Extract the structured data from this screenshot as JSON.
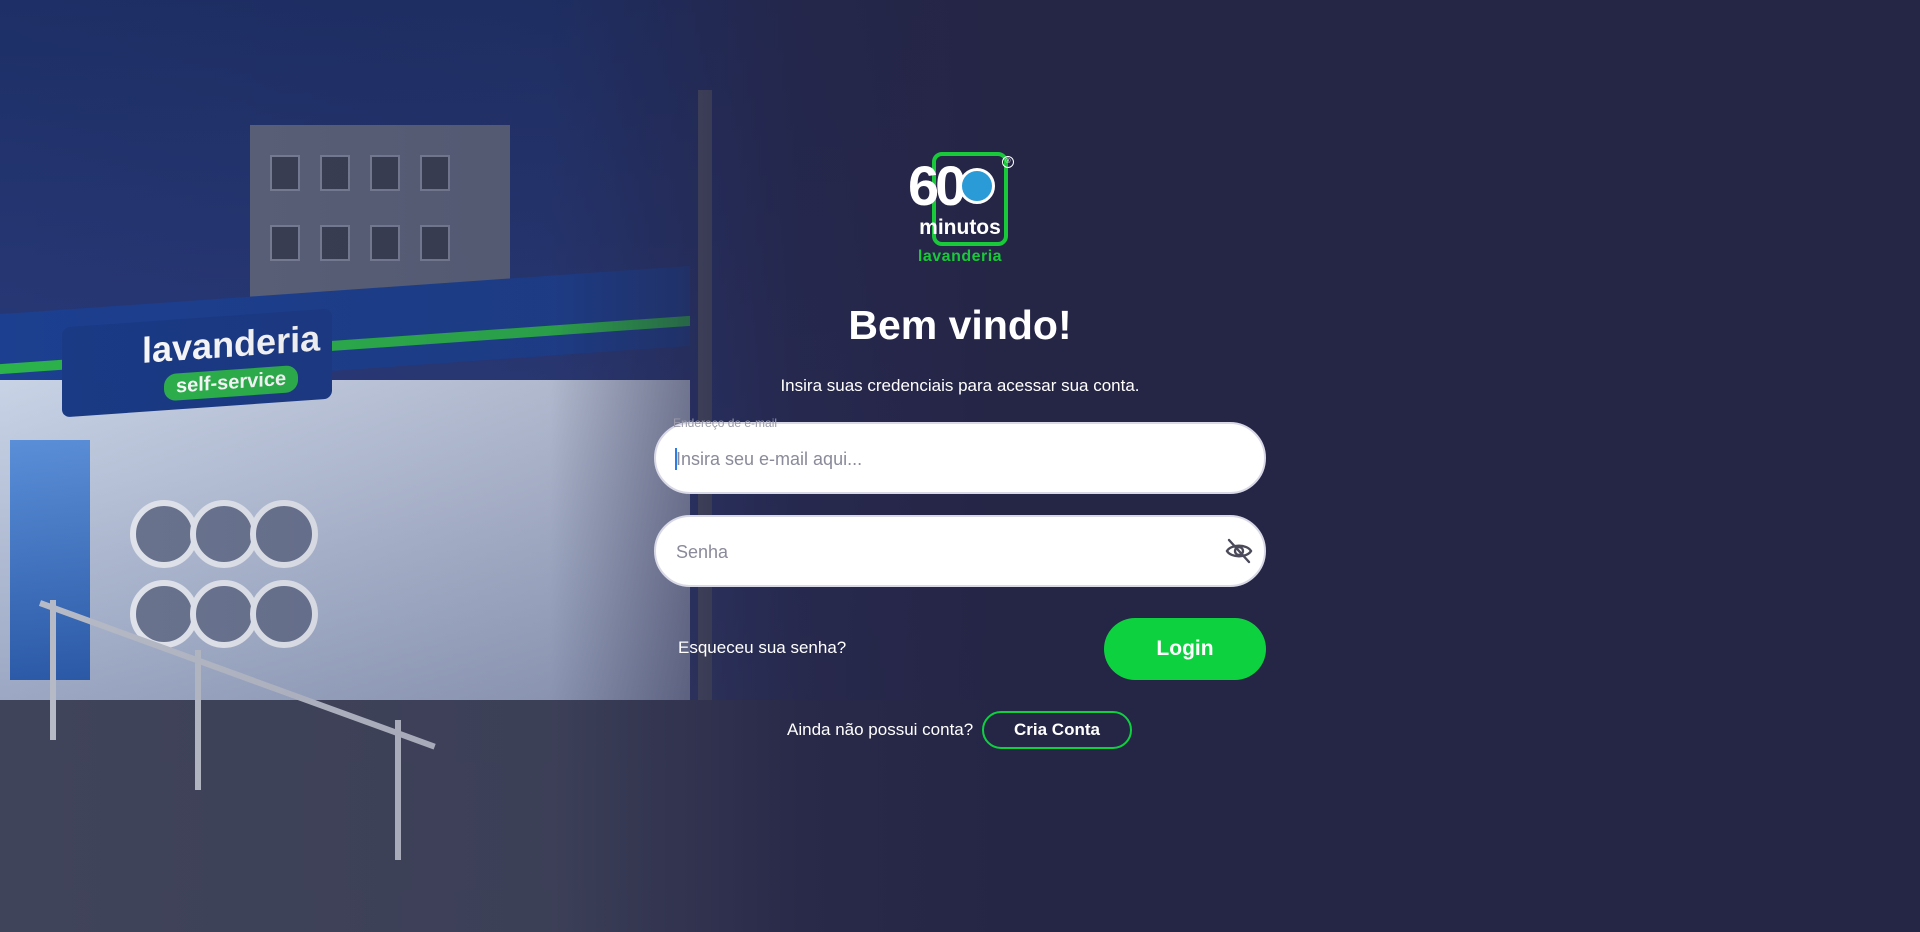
{
  "background": {
    "store_sign_text": "lavanderia",
    "store_sign_pill": "self-service"
  },
  "logo": {
    "number": "60",
    "word": "minutos",
    "subword": "lavanderia",
    "registered_mark": "®",
    "accent_color": "#19c93a"
  },
  "login": {
    "title": "Bem vindo!",
    "subtitle": "Insira suas credenciais para acessar sua conta.",
    "email": {
      "label": "Endereço de e-mail",
      "placeholder": "Insira seu e-mail aqui...",
      "value": ""
    },
    "password": {
      "placeholder": "Senha",
      "value": "",
      "toggle_icon": "eye-off-icon"
    },
    "forgot_password": "Esqueceu sua senha?",
    "login_button": "Login",
    "no_account_text": "Ainda não possui conta?",
    "create_account_button": "Cria Conta"
  },
  "colors": {
    "background": "#252546",
    "primary_green": "#0ed140"
  }
}
